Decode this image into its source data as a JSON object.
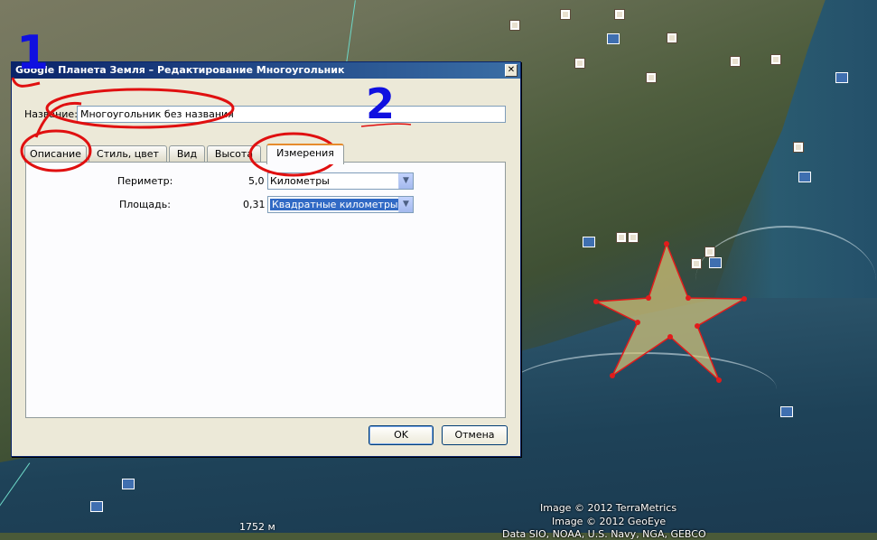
{
  "dialog": {
    "title": "Google Планета Земля – Редактирование Многоугольник",
    "close_glyph": "✕",
    "name_label": "Название:",
    "name_value": "Многоугольник без названия",
    "tabs": [
      {
        "label": "Описание"
      },
      {
        "label": "Стиль, цвет"
      },
      {
        "label": "Вид"
      },
      {
        "label": "Высота"
      },
      {
        "label": "Измерения",
        "active": true
      }
    ],
    "measurements": {
      "perimeter_label": "Периметр:",
      "perimeter_value": "5,0",
      "perimeter_unit": "Километры",
      "area_label": "Площадь:",
      "area_value": "0,31",
      "area_unit": "Квадратные километры"
    },
    "ok_label": "OK",
    "cancel_label": "Отмена"
  },
  "map": {
    "copyright_lines": [
      "Image © 2012 TerraMetrics",
      "Image © 2012 GeoEye",
      "Data SIO, NOAA, U.S. Navy, NGA, GEBCO"
    ],
    "scale_label": "1752 м",
    "polygon_fill": "#d8c87a",
    "polygon_stroke": "#e21b1b"
  },
  "annotations": {
    "mark_1": "1",
    "mark_2": "2",
    "color": "#1010e0",
    "circle_color": "#e01010"
  }
}
